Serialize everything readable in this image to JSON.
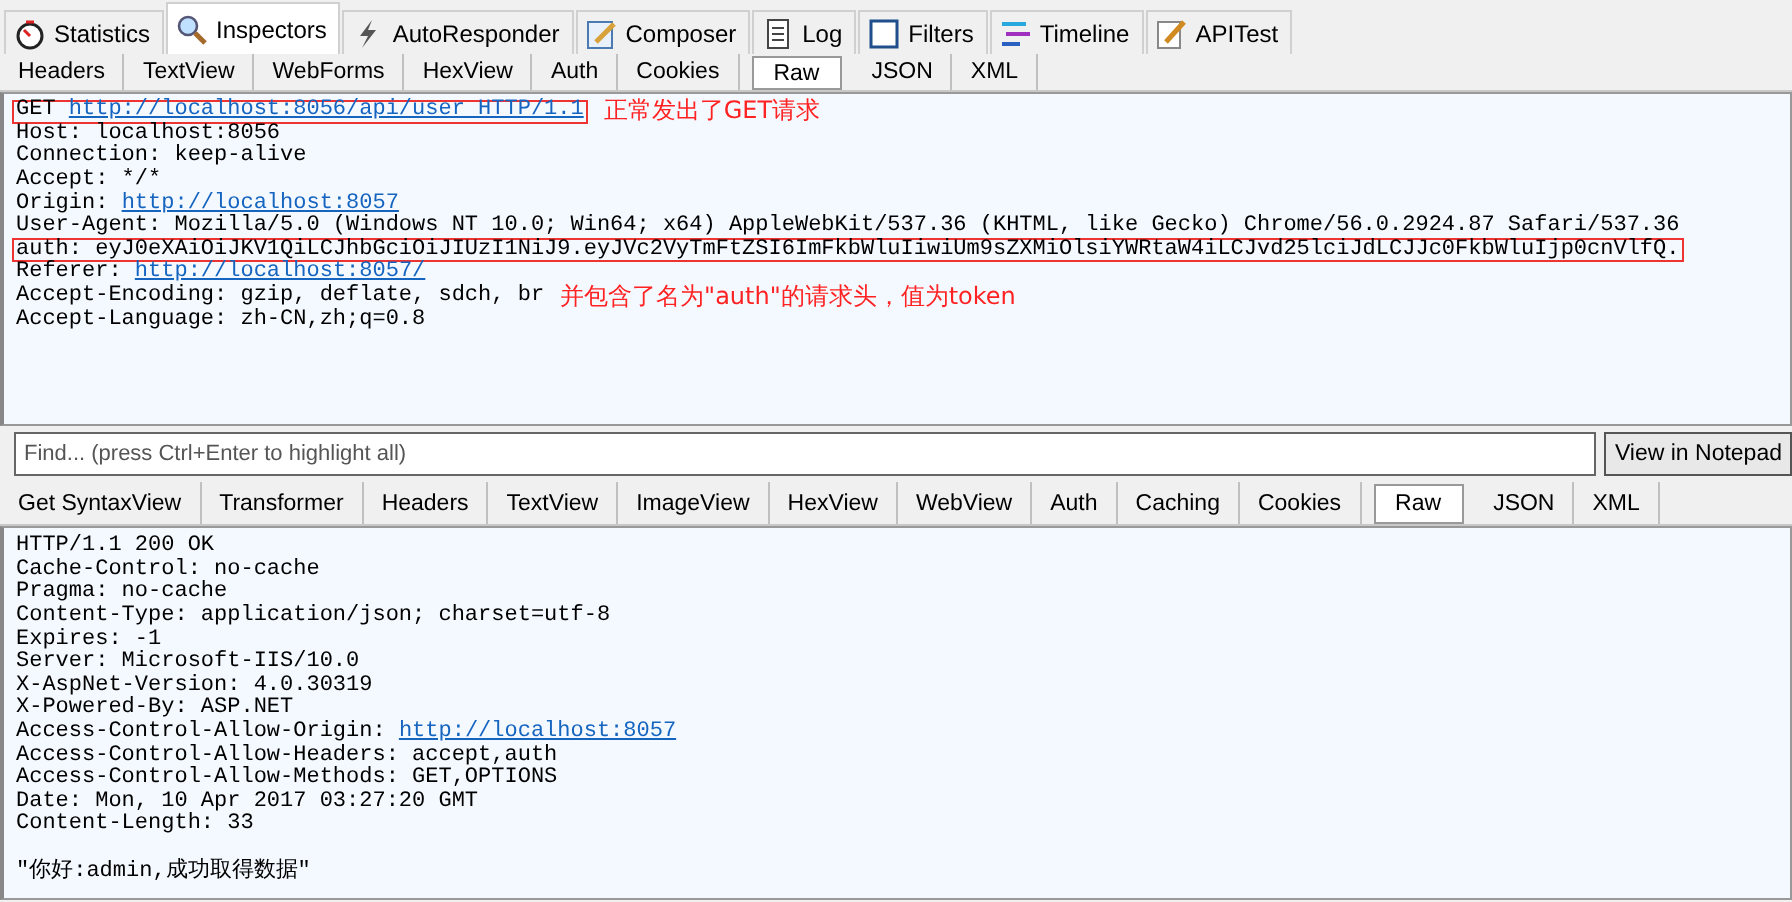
{
  "main_tabs": [
    {
      "label": "Statistics",
      "selected": false
    },
    {
      "label": "Inspectors",
      "selected": true
    },
    {
      "label": "AutoResponder",
      "selected": false
    },
    {
      "label": "Composer",
      "selected": false
    },
    {
      "label": "Log",
      "selected": false
    },
    {
      "label": "Filters",
      "selected": false
    },
    {
      "label": "Timeline",
      "selected": false
    },
    {
      "label": "APITest",
      "selected": false
    }
  ],
  "request": {
    "tabs": [
      {
        "label": "Headers",
        "selected": false
      },
      {
        "label": "TextView",
        "selected": false
      },
      {
        "label": "WebForms",
        "selected": false
      },
      {
        "label": "HexView",
        "selected": false
      },
      {
        "label": "Auth",
        "selected": false
      },
      {
        "label": "Cookies",
        "selected": false
      },
      {
        "label": "Raw",
        "selected": true
      },
      {
        "label": "JSON",
        "selected": false
      },
      {
        "label": "XML",
        "selected": false
      }
    ],
    "lines": [
      {
        "parts": [
          {
            "text": "GET "
          },
          {
            "text": "http://localhost:8056/api/user HTTP/1.1",
            "kind": "link"
          }
        ],
        "boxed": true,
        "note": "正常发出了GET请求"
      },
      {
        "parts": [
          {
            "text": "Host: localhost:8056"
          }
        ]
      },
      {
        "parts": [
          {
            "text": "Connection: keep-alive"
          }
        ]
      },
      {
        "parts": [
          {
            "text": "Accept: */*"
          }
        ]
      },
      {
        "parts": [
          {
            "text": "Origin: "
          },
          {
            "text": "http://localhost:8057",
            "kind": "link"
          }
        ]
      },
      {
        "parts": [
          {
            "text": "User-Agent: Mozilla/5.0 (Windows NT 10.0; Win64; x64) AppleWebKit/537.36 (KHTML, like Gecko) Chrome/56.0.2924.87 Safari/537.36"
          }
        ]
      },
      {
        "parts": [
          {
            "text": "auth: eyJ0eXAiOiJKV1QiLCJhbGciOiJIUzI1NiJ9.eyJVc2VyTmFtZSI6ImFkbWluIiwiUm9sZXMiOlsiYWRtaW4iLCJvd25lciJdLCJJc0FkbWluIjp0cnVlfQ."
          }
        ],
        "boxed": true
      },
      {
        "parts": [
          {
            "text": "Referer: "
          },
          {
            "text": "http://localhost:8057/",
            "kind": "link"
          }
        ]
      },
      {
        "parts": [
          {
            "text": "Accept-Encoding: gzip, deflate, sdch, br"
          }
        ],
        "note": "并包含了名为\"auth\"的请求头，值为token"
      },
      {
        "parts": [
          {
            "text": "Accept-Language: zh-CN,zh;q=0.8"
          }
        ]
      }
    ]
  },
  "find": {
    "placeholder": "Find... (press Ctrl+Enter to highlight all)",
    "button": "View in Notepad"
  },
  "response": {
    "tabs": [
      {
        "label": "Get SyntaxView",
        "selected": false
      },
      {
        "label": "Transformer",
        "selected": false
      },
      {
        "label": "Headers",
        "selected": false
      },
      {
        "label": "TextView",
        "selected": false
      },
      {
        "label": "ImageView",
        "selected": false
      },
      {
        "label": "HexView",
        "selected": false
      },
      {
        "label": "WebView",
        "selected": false
      },
      {
        "label": "Auth",
        "selected": false
      },
      {
        "label": "Caching",
        "selected": false
      },
      {
        "label": "Cookies",
        "selected": false
      },
      {
        "label": "Raw",
        "selected": true
      },
      {
        "label": "JSON",
        "selected": false
      },
      {
        "label": "XML",
        "selected": false
      }
    ],
    "lines": [
      {
        "parts": [
          {
            "text": "HTTP/1.1 200 OK"
          }
        ]
      },
      {
        "parts": [
          {
            "text": "Cache-Control: no-cache"
          }
        ]
      },
      {
        "parts": [
          {
            "text": "Pragma: no-cache"
          }
        ]
      },
      {
        "parts": [
          {
            "text": "Content-Type: application/json; charset=utf-8"
          }
        ]
      },
      {
        "parts": [
          {
            "text": "Expires: -1"
          }
        ]
      },
      {
        "parts": [
          {
            "text": "Server: Microsoft-IIS/10.0"
          }
        ]
      },
      {
        "parts": [
          {
            "text": "X-AspNet-Version: 4.0.30319"
          }
        ]
      },
      {
        "parts": [
          {
            "text": "X-Powered-By: ASP.NET"
          }
        ]
      },
      {
        "parts": [
          {
            "text": "Access-Control-Allow-Origin: "
          },
          {
            "text": "http://localhost:8057",
            "kind": "link"
          }
        ]
      },
      {
        "parts": [
          {
            "text": "Access-Control-Allow-Headers: accept,auth"
          }
        ]
      },
      {
        "parts": [
          {
            "text": "Access-Control-Allow-Methods: GET,OPTIONS"
          }
        ]
      },
      {
        "parts": [
          {
            "text": "Date: Mon, 10 Apr 2017 03:27:20 GMT"
          }
        ]
      },
      {
        "parts": [
          {
            "text": "Content-Length: 33"
          }
        ]
      }
    ],
    "body": "\"你好:admin,成功取得数据\""
  }
}
